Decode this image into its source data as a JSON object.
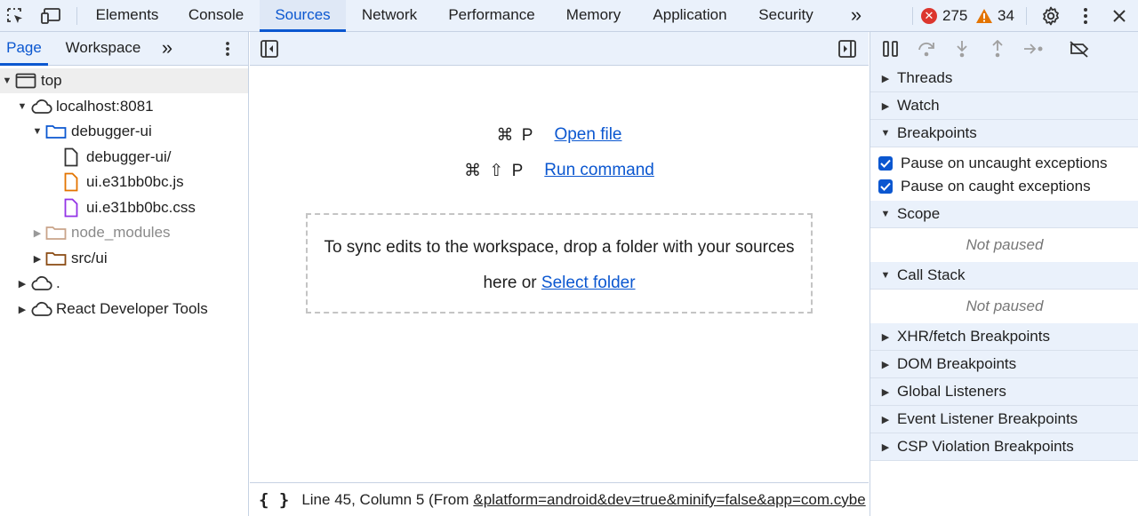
{
  "top_tabs": [
    "Elements",
    "Console",
    "Sources",
    "Network",
    "Performance",
    "Memory",
    "Application",
    "Security"
  ],
  "active_tab": "Sources",
  "more_glyph": "»",
  "errors_count": "275",
  "warnings_count": "34",
  "navigator": {
    "tabs": [
      "Page",
      "Workspace"
    ],
    "active_tab": "Page",
    "tree": [
      {
        "label": "top",
        "icon": "frame-icon"
      },
      {
        "label": "localhost:8081",
        "icon": "cloud-icon"
      },
      {
        "label": "debugger-ui",
        "icon": "folder-icon"
      },
      {
        "label": "debugger-ui/",
        "icon": "document-icon"
      },
      {
        "label": "ui.e31bb0bc.js",
        "icon": "js-file-icon"
      },
      {
        "label": "ui.e31bb0bc.css",
        "icon": "css-file-icon"
      },
      {
        "label": "node_modules",
        "icon": "folder-icon"
      },
      {
        "label": "src/ui",
        "icon": "folder-icon"
      },
      {
        "label": ".",
        "icon": "cloud-icon"
      },
      {
        "label": "React Developer Tools",
        "icon": "cloud-icon"
      }
    ]
  },
  "editor": {
    "open_file_shortcut": "⌘ P",
    "open_file_label": "Open file",
    "run_command_shortcut": "⌘ ⇧ P",
    "run_command_label": "Run command",
    "dropzone_text": "To sync edits to the workspace, drop a folder with your sources here or",
    "select_folder_label": "Select folder",
    "status_prefix": "Line 45, Column 5  (From",
    "status_link": "&platform=android&dev=true&minify=false&app=com.cybe"
  },
  "debugger": {
    "sections_top": [
      "Threads",
      "Watch",
      "Breakpoints"
    ],
    "breakpoint_options": [
      "Pause on uncaught exceptions",
      "Pause on caught exceptions"
    ],
    "scope": "Scope",
    "scope_status": "Not paused",
    "call_stack": "Call Stack",
    "call_stack_status": "Not paused",
    "sections_bottom": [
      "XHR/fetch Breakpoints",
      "DOM Breakpoints",
      "Global Listeners",
      "Event Listener Breakpoints",
      "CSP Violation Breakpoints"
    ]
  },
  "colors": {
    "accent": "#0b57d0",
    "panel_bg": "#eaf1fb",
    "error": "#dc362e",
    "warning": "#e37400"
  }
}
